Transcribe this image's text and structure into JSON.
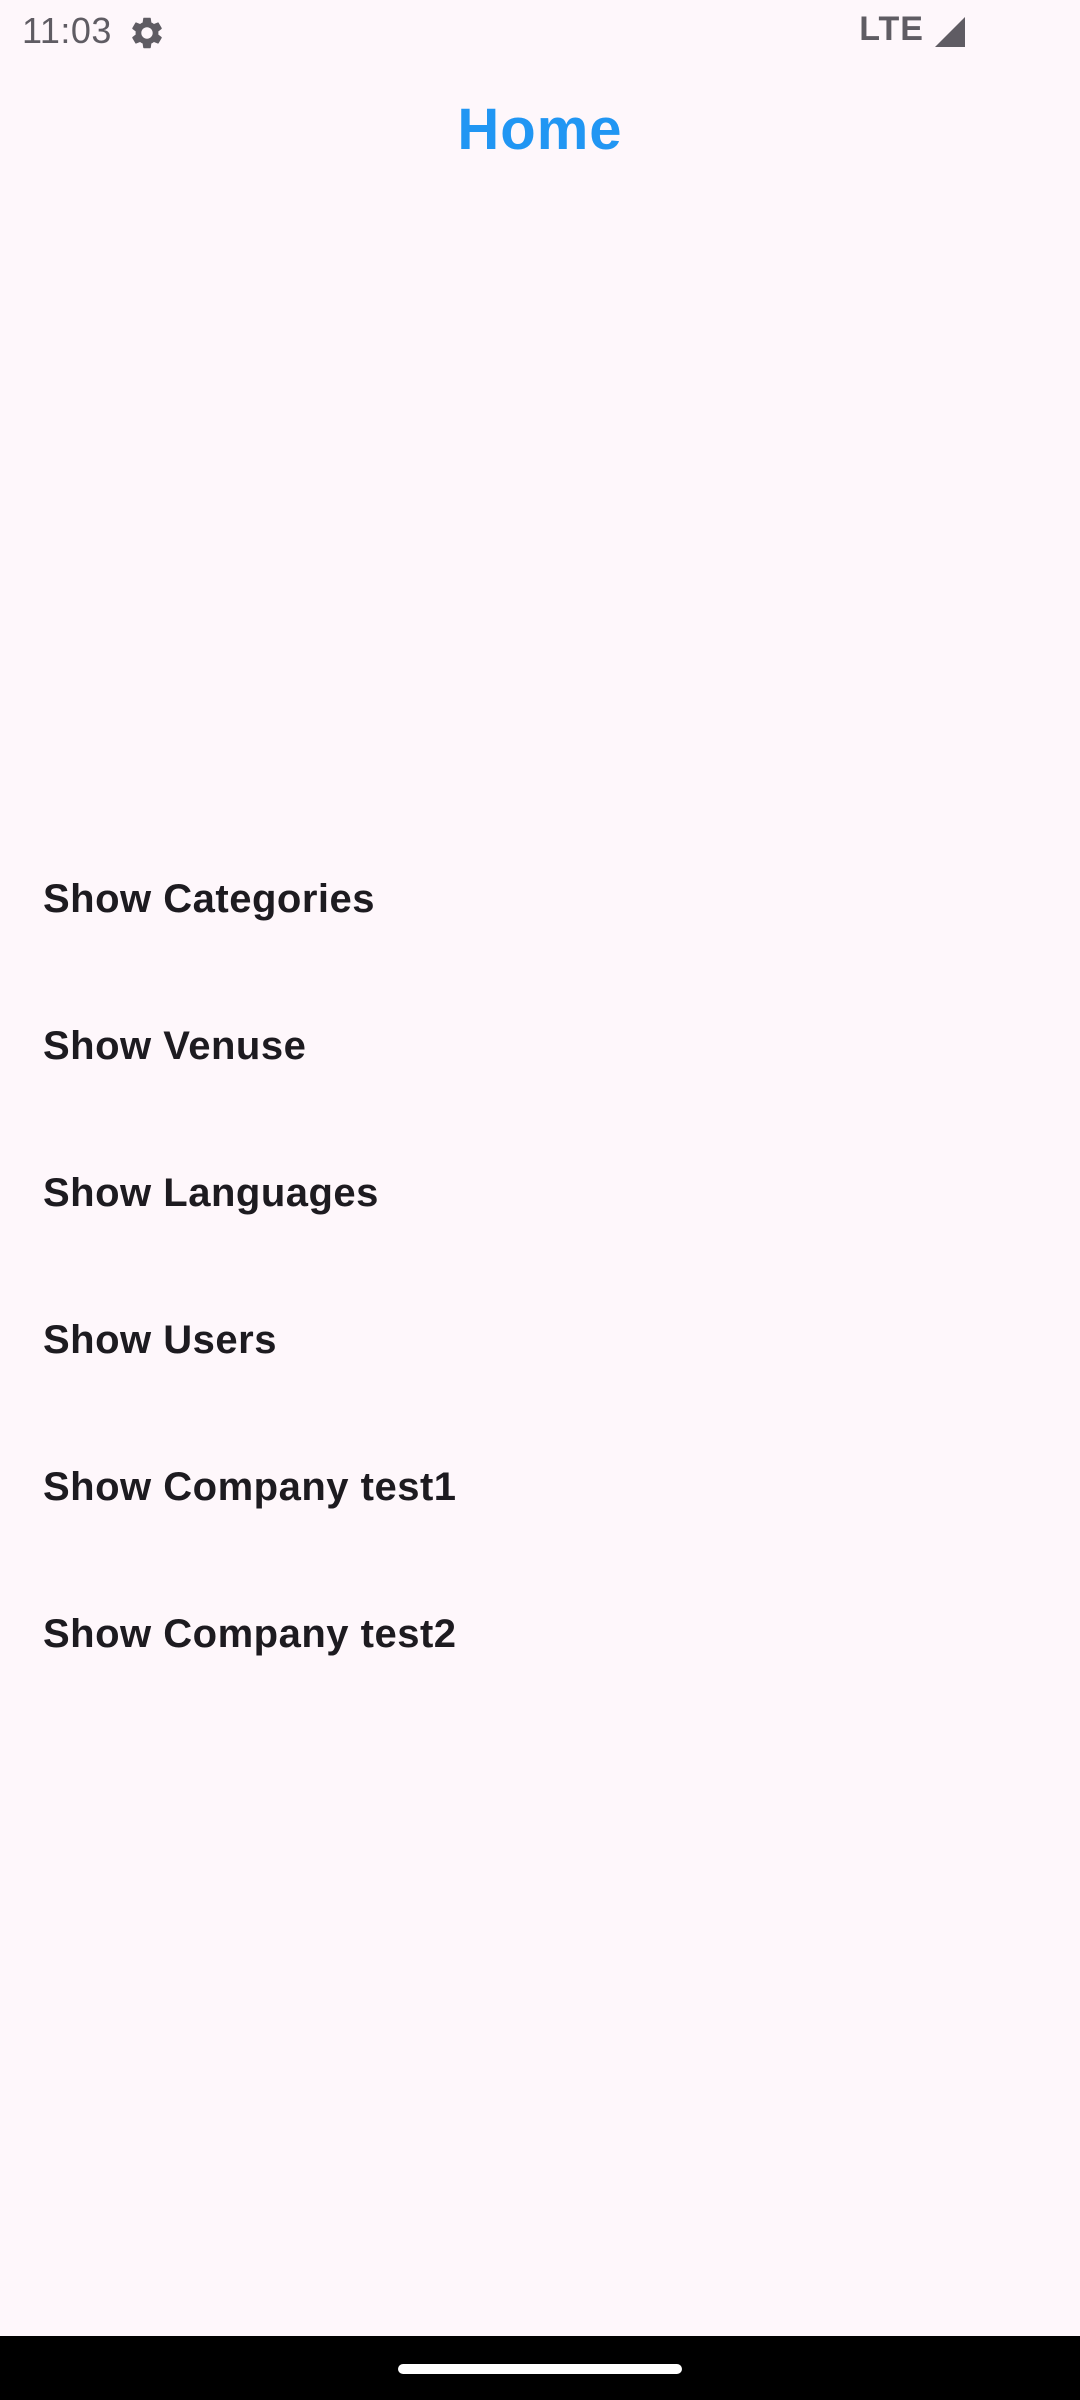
{
  "status_bar": {
    "time": "11:03",
    "settings_icon": "gear-icon",
    "network_label": "LTE",
    "signal_icon": "signal-icon"
  },
  "header": {
    "title": "Home"
  },
  "menu": {
    "items": [
      {
        "label": "Show Categories"
      },
      {
        "label": "Show Venuse"
      },
      {
        "label": "Show Languages"
      },
      {
        "label": "Show Users"
      },
      {
        "label": "Show Company test1"
      },
      {
        "label": "Show Company test2"
      }
    ]
  },
  "colors": {
    "background": "#fef7fb",
    "title": "#2196f3",
    "text": "#1d1b20",
    "status_text": "#5f5c63",
    "nav_bar": "#000000"
  }
}
